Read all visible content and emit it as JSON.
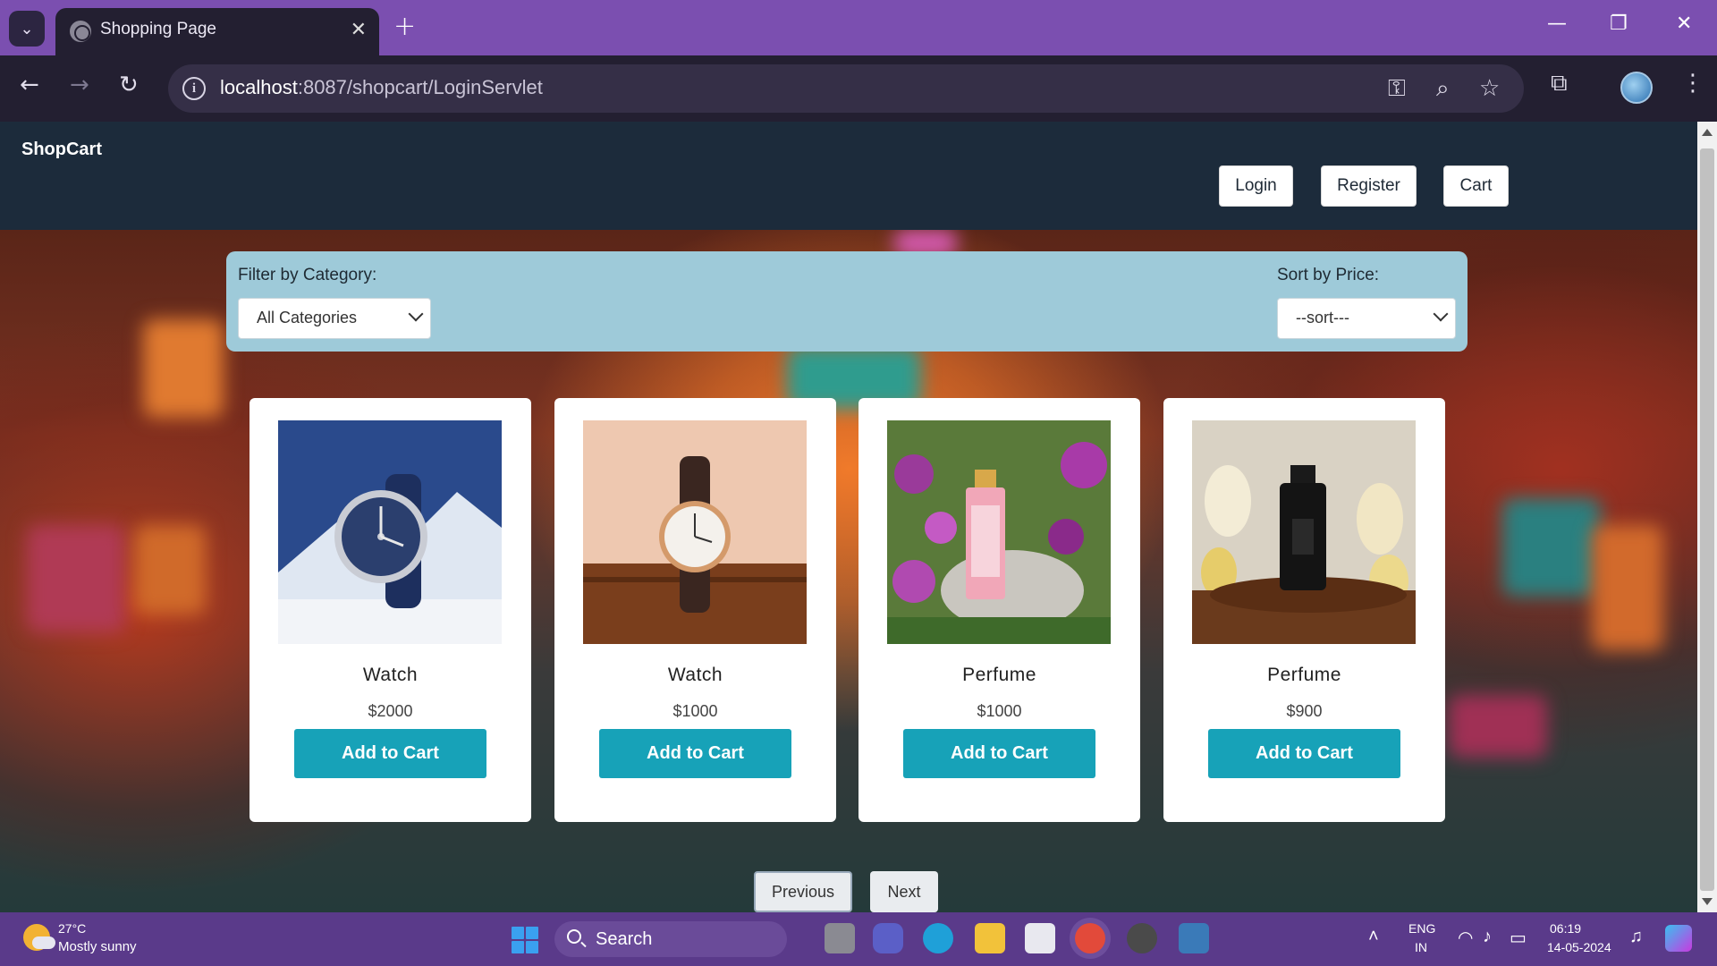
{
  "browser": {
    "tab_title": "Shopping Page",
    "url_host": "localhost",
    "url_path": ":8087/shopcart/LoginServlet",
    "new_tab_symbol": "+",
    "close_tab_symbol": "✕"
  },
  "site": {
    "logo": "ShopCart",
    "nav": {
      "login": "Login",
      "register": "Register",
      "cart": "Cart"
    }
  },
  "filters": {
    "category_label": "Filter by Category:",
    "category_value": "All Categories",
    "sort_label": "Sort by Price:",
    "sort_value": "--sort---"
  },
  "products": [
    {
      "name": "Watch",
      "price": "$2000",
      "button": "Add to Cart"
    },
    {
      "name": "Watch",
      "price": "$1000",
      "button": "Add to Cart"
    },
    {
      "name": "Perfume",
      "price": "$1000",
      "button": "Add to Cart"
    },
    {
      "name": "Perfume",
      "price": "$900",
      "button": "Add to Cart"
    }
  ],
  "pagination": {
    "previous": "Previous",
    "next": "Next"
  },
  "taskbar": {
    "temperature": "27°C",
    "condition": "Mostly sunny",
    "search": "Search",
    "lang_top": "ENG",
    "lang_bottom": "IN",
    "time": "06:19",
    "date": "14-05-2024"
  },
  "colors": {
    "tabbar": "#7b4fb0",
    "site_header": "#1c2b3b",
    "filter_bar": "#9ecad9",
    "add_button": "#17a2b8",
    "taskbar": "#5a3a8a"
  }
}
